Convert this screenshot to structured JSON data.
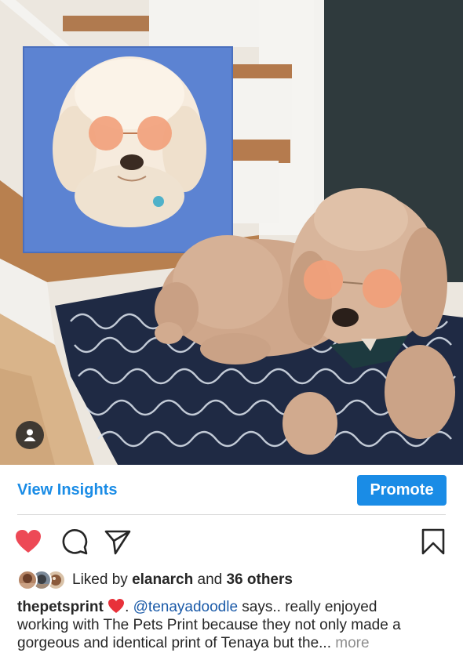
{
  "post": {
    "insights_label": "View Insights",
    "promote_label": "Promote",
    "liked_by_prefix": "Liked by",
    "liked_by_user": "elanarch",
    "liked_by_and": "and",
    "liked_by_others": "36 others",
    "caption": {
      "username": "thepetsprint",
      "after_emoji": ".",
      "mention": "@tenayadoodle",
      "line1_rest": "says.. really enjoyed",
      "line2": "working with The Pets Print because they not only made a",
      "line3": "gorgeous and identical print of Tenaya but the...",
      "more_label": "more"
    }
  },
  "icons": {
    "like": "heart-filled-icon",
    "comment": "comment-bubble-icon",
    "share": "paper-plane-icon",
    "save": "bookmark-icon",
    "tag": "user-tag-icon"
  },
  "colors": {
    "accent": "#1a8ce6",
    "like_red": "#ed4956",
    "mention": "#1a5aa8",
    "muted": "#8e8e8e"
  }
}
